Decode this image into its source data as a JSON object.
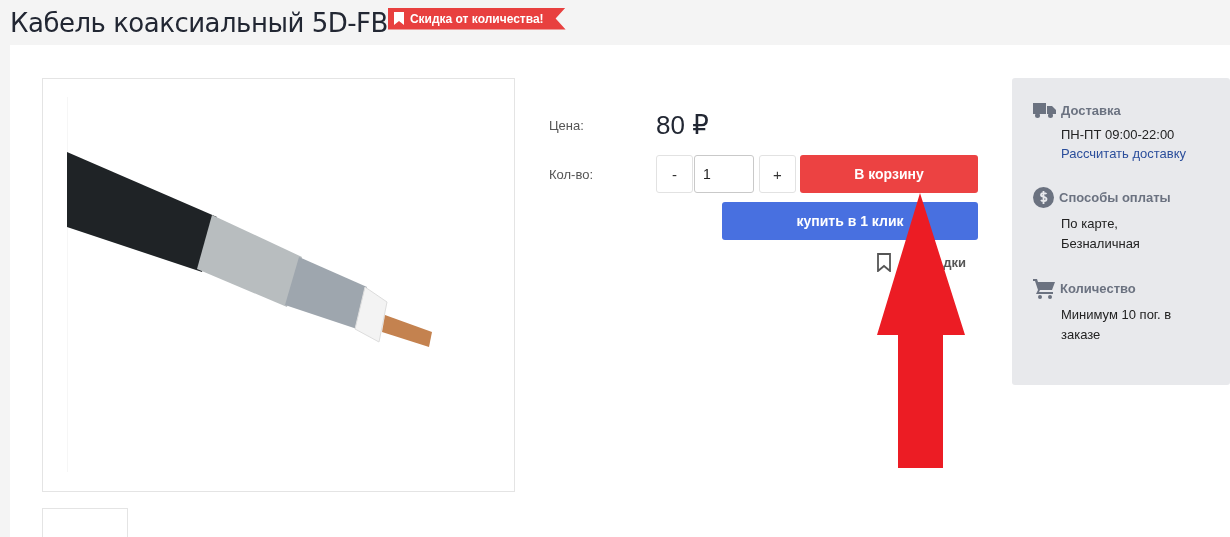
{
  "title": "Кабель коаксиальный 5D-FB",
  "promo_badge": "Скидка от количества!",
  "price": {
    "label": "Цена:",
    "value": "80 ₽"
  },
  "quantity": {
    "label": "Кол-во:",
    "minus": "-",
    "value": "1",
    "plus": "+"
  },
  "buttons": {
    "cart": "В корзину",
    "one_click": "купить в 1 клик"
  },
  "bookmark": {
    "label": "дки"
  },
  "info": [
    {
      "kind": "delivery",
      "title": "Доставка",
      "lines": [
        "ПН-ПТ 09:00-22:00"
      ],
      "link": "Рассчитать доставку"
    },
    {
      "kind": "payment",
      "title": "Способы оплаты",
      "lines": [
        "По карте,",
        "Безналичная"
      ]
    },
    {
      "kind": "quantity",
      "title": "Количество",
      "lines": [
        "Минимум 10 пог. в заказе"
      ]
    }
  ]
}
